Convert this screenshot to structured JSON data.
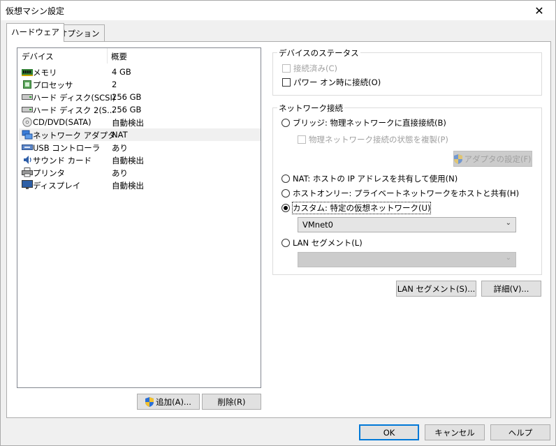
{
  "window": {
    "title": "仮想マシン設定",
    "close_glyph": "✕"
  },
  "tabs": [
    {
      "label": "ハードウェア",
      "active": true
    },
    {
      "label": "オプション",
      "active": false
    }
  ],
  "device_list": {
    "col_device": "デバイス",
    "col_summary": "概要",
    "rows": [
      {
        "icon": "memory-icon",
        "name": "メモリ",
        "summary": "4 GB",
        "selected": false
      },
      {
        "icon": "processor-icon",
        "name": "プロセッサ",
        "summary": "2",
        "selected": false
      },
      {
        "icon": "hard-disk-icon",
        "name": "ハード ディスク(SCSI)",
        "summary": "256 GB",
        "selected": false
      },
      {
        "icon": "hard-disk-icon",
        "name": "ハード ディスク 2(S...",
        "summary": "256 GB",
        "selected": false
      },
      {
        "icon": "cd-dvd-icon",
        "name": "CD/DVD(SATA)",
        "summary": "自動検出",
        "selected": false
      },
      {
        "icon": "network-adapter-icon",
        "name": "ネットワーク アダプタ",
        "summary": "NAT",
        "selected": true
      },
      {
        "icon": "usb-icon",
        "name": "USB コントローラ",
        "summary": "あり",
        "selected": false
      },
      {
        "icon": "sound-card-icon",
        "name": "サウンド カード",
        "summary": "自動検出",
        "selected": false
      },
      {
        "icon": "printer-icon",
        "name": "プリンタ",
        "summary": "あり",
        "selected": false
      },
      {
        "icon": "display-icon",
        "name": "ディスプレイ",
        "summary": "自動検出",
        "selected": false
      }
    ]
  },
  "list_buttons": {
    "add": "追加(A)...",
    "remove": "削除(R)"
  },
  "device_status": {
    "legend": "デバイスのステータス",
    "connected": "接続済み(C)",
    "connect_at_power_on": "パワー オン時に接続(O)"
  },
  "network": {
    "legend": "ネットワーク接続",
    "bridged": "ブリッジ: 物理ネットワークに直接接続(B)",
    "replicate": "物理ネットワーク接続の状態を複製(P)",
    "adapter_settings": "アダプタの設定(F)",
    "nat": "NAT: ホストの IP アドレスを共有して使用(N)",
    "host_only": "ホストオンリー: プライベートネットワークをホストと共有(H)",
    "custom": "カスタム: 特定の仮想ネットワーク(U)",
    "custom_select_value": "VMnet0",
    "lan_segment": "LAN セグメント(L)",
    "lan_select_value": "",
    "selected_option": "custom"
  },
  "panel_buttons": {
    "lan_segments": "LAN セグメント(S)...",
    "advanced": "詳細(V)..."
  },
  "dialog_buttons": {
    "ok": "OK",
    "cancel": "キャンセル",
    "help": "ヘルプ"
  },
  "colors": {
    "focus_blue": "#0078d7",
    "shield_blue": "#2a6fd6",
    "shield_yellow": "#f2c12e"
  }
}
